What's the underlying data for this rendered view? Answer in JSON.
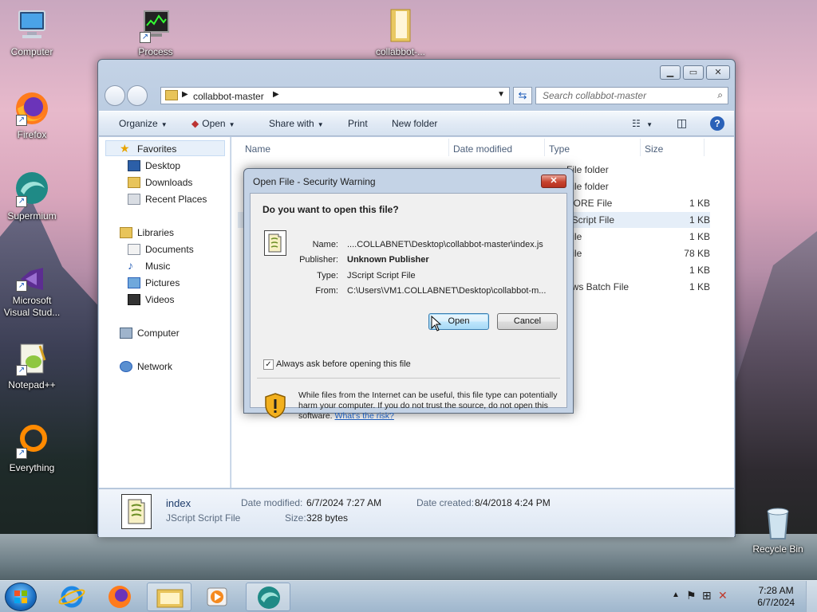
{
  "desktop": {
    "icons": [
      {
        "label": "Computer"
      },
      {
        "label": "Process"
      },
      {
        "label": "collabbot-..."
      },
      {
        "label": "Firefox"
      },
      {
        "label": "Supermium"
      },
      {
        "label": "Microsoft Visual Stud..."
      },
      {
        "label": "Notepad++"
      },
      {
        "label": "Everything"
      },
      {
        "label": "Recycle Bin"
      }
    ]
  },
  "explorer": {
    "breadcrumb": "collabbot-master",
    "search_placeholder": "Search collabbot-master",
    "toolbar": {
      "organize": "Organize",
      "open": "Open",
      "share_with": "Share with",
      "print": "Print",
      "new_folder": "New folder"
    },
    "nav": {
      "favorites": "Favorites",
      "desktop": "Desktop",
      "downloads": "Downloads",
      "recent_places": "Recent Places",
      "libraries": "Libraries",
      "documents": "Documents",
      "music": "Music",
      "pictures": "Pictures",
      "videos": "Videos",
      "computer": "Computer",
      "network": "Network"
    },
    "columns": {
      "name": "Name",
      "date_modified": "Date modified",
      "type": "Type",
      "size": "Size"
    },
    "visible_rows": [
      {
        "type": "File folder",
        "size": ""
      },
      {
        "type": "File folder",
        "size": ""
      },
      {
        "type": "NORE File",
        "size": "1 KB"
      },
      {
        "type": "t Script File",
        "size": "1 KB"
      },
      {
        "type": "File",
        "size": "1 KB"
      },
      {
        "type": "File",
        "size": "78 KB"
      },
      {
        "type": "le",
        "size": "1 KB"
      },
      {
        "type": "ows Batch File",
        "size": "1 KB"
      }
    ],
    "details": {
      "name": "index",
      "type": "JScript Script File",
      "date_modified_label": "Date modified:",
      "date_modified": "6/7/2024 7:27 AM",
      "size_label": "Size:",
      "size": "328 bytes",
      "date_created_label": "Date created:",
      "date_created": "8/4/2018 4:24 PM"
    }
  },
  "dialog": {
    "title": "Open File - Security Warning",
    "question": "Do you want to open this file?",
    "name_label": "Name:",
    "name": "....COLLABNET\\Desktop\\collabbot-master\\index.js",
    "publisher_label": "Publisher:",
    "publisher": "Unknown Publisher",
    "type_label": "Type:",
    "type": "JScript Script File",
    "from_label": "From:",
    "from": "C:\\Users\\VM1.COLLABNET\\Desktop\\collabbot-m...",
    "open_button": "Open",
    "cancel_button": "Cancel",
    "always_ask_label": "Always ask before opening this file",
    "always_ask_checked": true,
    "warning_text": "While files from the Internet can be useful, this file type can potentially harm your computer. If you do not trust the source, do not open this software.",
    "risk_link": "What's the risk?"
  },
  "taskbar": {
    "time": "7:28 AM",
    "date": "6/7/2024"
  }
}
